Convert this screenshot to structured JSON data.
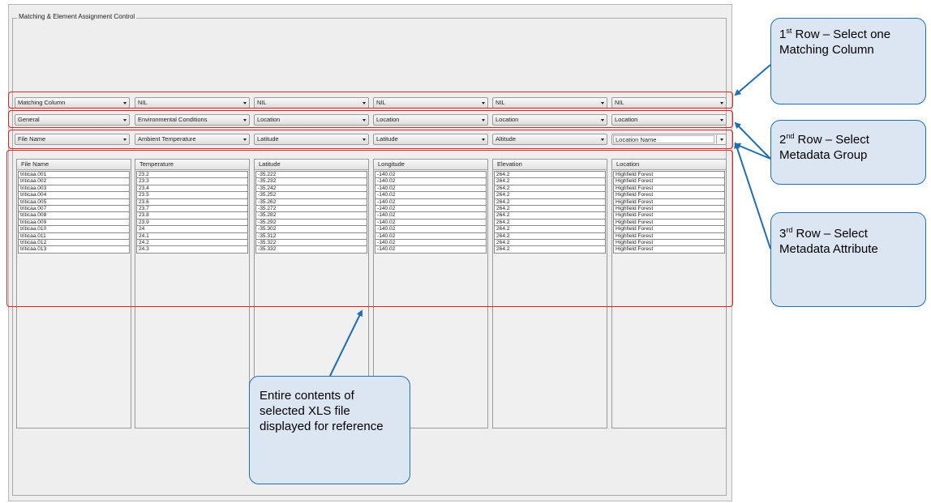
{
  "panel": {
    "title": "Matching & Element Assignment Control"
  },
  "row1": [
    {
      "value": "Matching Column"
    },
    {
      "value": "NIL"
    },
    {
      "value": "NIL"
    },
    {
      "value": "NIL"
    },
    {
      "value": "NIL"
    },
    {
      "value": "NIL"
    }
  ],
  "row2": [
    {
      "value": "General"
    },
    {
      "value": "Environmental Conditions"
    },
    {
      "value": "Location"
    },
    {
      "value": "Location"
    },
    {
      "value": "Location"
    },
    {
      "value": "Location"
    }
  ],
  "row3": [
    {
      "value": "File Name"
    },
    {
      "value": "Ambient Temperature"
    },
    {
      "value": "Latitude"
    },
    {
      "value": "Latitude"
    },
    {
      "value": "Altitude"
    },
    {
      "value": "Location Name"
    }
  ],
  "table": {
    "columns": [
      {
        "header": "File Name",
        "cells": [
          "triticaa.001",
          "triticaa.002",
          "triticaa.003",
          "triticaa.004",
          "triticaa.005",
          "triticaa.007",
          "triticaa.008",
          "triticaa.009",
          "triticaa.010",
          "triticaa.011",
          "triticaa.012",
          "triticaa.013"
        ]
      },
      {
        "header": "Temperature",
        "cells": [
          "23.2",
          "23.3",
          "23.4",
          "23.5",
          "23.6",
          "23.7",
          "23.8",
          "23.9",
          "24",
          "24.1",
          "24.2",
          "24.3"
        ]
      },
      {
        "header": "Latitude",
        "cells": [
          "-35.222",
          "-35.232",
          "-35.242",
          "-35.252",
          "-35.262",
          "-35.272",
          "-35.282",
          "-35.292",
          "-35.302",
          "-35.312",
          "-35.322",
          "-35.332"
        ]
      },
      {
        "header": "Longitude",
        "cells": [
          "-140.02",
          "-140.02",
          "-140.02",
          "-140.02",
          "-140.02",
          "-140.02",
          "-140.02",
          "-140.02",
          "-140.02",
          "-140.02",
          "-140.02",
          "-140.02"
        ]
      },
      {
        "header": "Elevation",
        "cells": [
          "264.2",
          "264.2",
          "264.2",
          "264.2",
          "264.2",
          "264.2",
          "264.2",
          "264.2",
          "264.2",
          "264.2",
          "264.2",
          "264.2"
        ]
      },
      {
        "header": "Location",
        "cells": [
          "Highfield Forest",
          "Highfield Forest",
          "Highfield Forest",
          "Highfield Forest",
          "Highfield Forest",
          "Highfield Forest",
          "Highfield Forest",
          "Highfield Forest",
          "Highfield Forest",
          "Highfield Forest",
          "Highfield Forest",
          "Highfield Forest"
        ]
      }
    ]
  },
  "callouts": {
    "row1": {
      "ordinal": "1",
      "suffix": "st",
      "text": " Row – Select one Matching Column"
    },
    "row2": {
      "ordinal": "2",
      "suffix": "nd",
      "text": " Row – Select Metadata Group"
    },
    "row3": {
      "ordinal": "3",
      "suffix": "rd",
      "text": " Row – Select Metadata Attribute"
    },
    "contents": {
      "text": "Entire contents of selected XLS file displayed for reference"
    }
  },
  "colors": {
    "highlight_border": "#e01f1f",
    "callout_fill": "#dce6f2",
    "callout_border": "#1f6fb4",
    "panel_bg": "#eeeeee"
  },
  "icons": {
    "combo_dropdown": "chevron-down-icon"
  }
}
